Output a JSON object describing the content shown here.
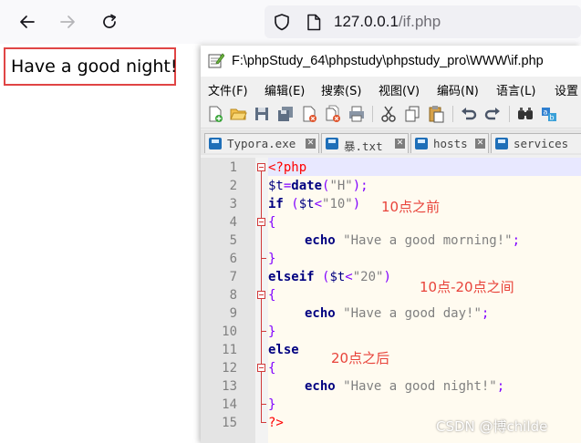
{
  "browser": {
    "url_host": "127.0.0.1",
    "url_path": "/if.php",
    "back_icon": "back-arrow-icon",
    "forward_icon": "forward-arrow-icon",
    "reload_icon": "reload-icon",
    "security_icon": "shield-icon",
    "page_icon": "page-icon"
  },
  "page": {
    "output_text": "Have a good night!"
  },
  "editor_window": {
    "title": "F:\\phpStudy_64\\phpstudy\\phpstudy_pro\\WWW\\if.php",
    "menu": [
      "文件(F)",
      "编辑(E)",
      "搜索(S)",
      "视图(V)",
      "编码(N)",
      "语言(L)",
      "设置"
    ],
    "toolbar_icons": [
      "new-file-icon",
      "open-file-icon",
      "save-icon",
      "save-all-icon",
      "close-icon",
      "close-all-icon",
      "print-icon",
      "cut-icon",
      "copy-icon",
      "paste-icon",
      "undo-icon",
      "redo-icon",
      "find-icon",
      "replace-icon"
    ],
    "tabs": [
      {
        "label": "Typora.exe"
      },
      {
        "label": "暴.txt"
      },
      {
        "label": "hosts"
      },
      {
        "label": "services"
      }
    ],
    "line_numbers": [
      "1",
      "2",
      "3",
      "4",
      "5",
      "6",
      "7",
      "8",
      "9",
      "10",
      "11",
      "12",
      "13",
      "14",
      "15"
    ],
    "code": {
      "l1": "<?php",
      "l2_var": "$t",
      "l2_eq": "=",
      "l2_fn": "date",
      "l2_open": "(",
      "l2_str": "\"H\"",
      "l2_close": ");",
      "l3_kw": "if",
      "l3_open": " (",
      "l3_var": "$t",
      "l3_op": "<",
      "l3_str": "\"10\"",
      "l3_close": ")",
      "l4": "{",
      "l5_kw": "echo",
      "l5_str": "\"Have a good morning!\"",
      "l5_end": ";",
      "l6": "}",
      "l7_kw": "elseif",
      "l7_open": " (",
      "l7_var": "$t",
      "l7_op": "<",
      "l7_str": "\"20\"",
      "l7_close": ")",
      "l8": "{",
      "l9_kw": "echo",
      "l9_str": "\"Have a good day!\"",
      "l9_end": ";",
      "l10": "}",
      "l11_kw": "else",
      "l12": "{",
      "l13_kw": "echo",
      "l13_str": "\"Have a good night!\"",
      "l13_end": ";",
      "l14": "}",
      "l15": "?>"
    },
    "annotations": {
      "before_10": "10点之前",
      "between_10_20": "10点-20点之间",
      "after_20": "20点之后"
    }
  },
  "watermark": "CSDN @博childe",
  "colors": {
    "annotation": "#e8433a",
    "highlight_border": "#e04545",
    "php_tag": "#ff0000",
    "keyword": "#000080",
    "string": "#808080",
    "operator": "#8000ff"
  }
}
